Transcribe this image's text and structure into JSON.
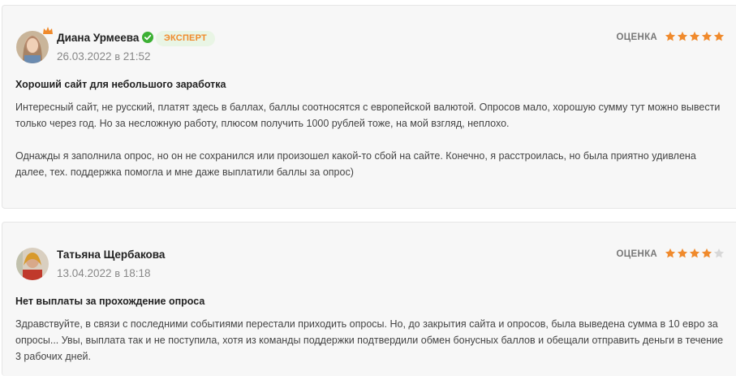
{
  "colors": {
    "accent_green": "#3cb034",
    "star_orange": "#f08a2c",
    "star_empty": "#d8d8d8",
    "badge_bg": "#e9f5e5"
  },
  "reviews": [
    {
      "author": "Диана Урмеева",
      "verified": true,
      "badge": "ЭКСПЕРТ",
      "date": "26.03.2022",
      "date_sep": "в",
      "time": "21:52",
      "rating_label": "ОЦЕНКА",
      "rating": 5,
      "rating_max": 5,
      "title": "Хороший сайт для небольшого заработка",
      "paragraphs": [
        "Интересный сайт, не русский, платят здесь в баллах, баллы соотносятся с европейской валютой. Опросов мало, хорошую сумму тут можно вывести только через год. Но за несложную работу, плюсом получить 1000 рублей тоже, на мой взгляд, неплохо.",
        "Однажды я заполнила опрос, но он не сохранился или произошел какой-то сбой на сайте. Конечно, я расстроилась, но была приятно удивлена далее, тех. поддержка помогла и мне даже выплатили баллы за опрос)"
      ]
    },
    {
      "author": "Татьяна Щербакова",
      "verified": false,
      "date": "13.04.2022",
      "date_sep": "в",
      "time": "18:18",
      "rating_label": "ОЦЕНКА",
      "rating": 4,
      "rating_max": 5,
      "title": "Нет выплаты за прохождение опроса",
      "paragraphs": [
        "Здравствуйте, в связи с последними событиями перестали приходить опросы. Но, до закрытия сайта и опросов, была выведена сумма в 10 евро за опросы... Увы, выплата так и не поступила, хотя из команды поддержки подтвердили обмен бонусных баллов и обещали отправить деньги в течение 3 рабочих дней."
      ]
    }
  ]
}
